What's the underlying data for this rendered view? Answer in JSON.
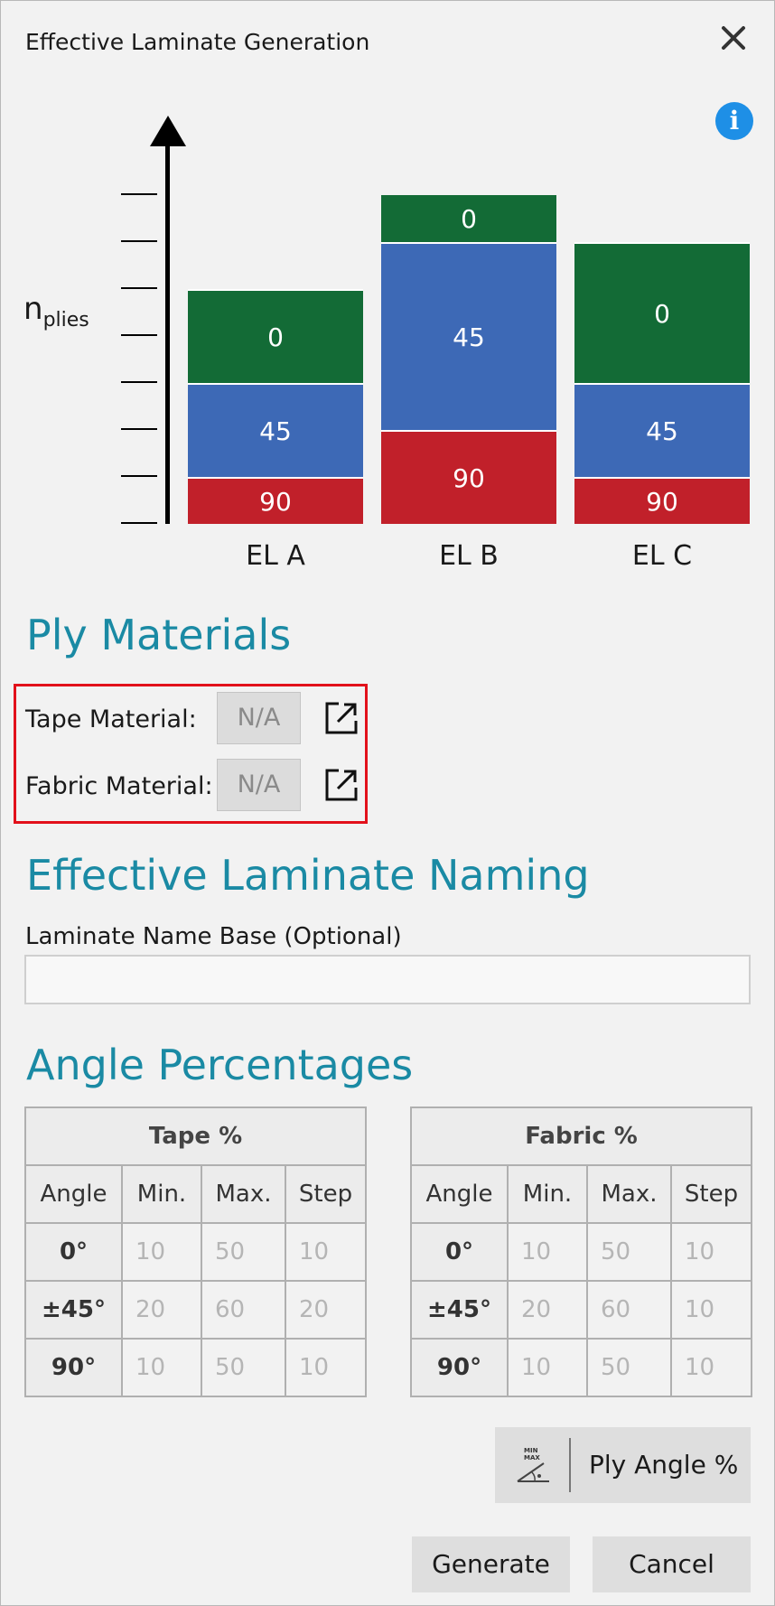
{
  "window": {
    "title": "Effective Laminate Generation"
  },
  "icons": {
    "close": "close-icon",
    "info": "info-icon",
    "external": "external-link-icon",
    "ply_angle": "min-max-angle-icon"
  },
  "colors": {
    "ply_0": "#136b36",
    "ply_45": "#3d69b6",
    "ply_90": "#c1202a",
    "heading": "#1a8aa4",
    "highlight_border": "#e2111b"
  },
  "chart_data": {
    "type": "bar",
    "stacked": true,
    "ylabel": {
      "main": "n",
      "sub": "plies"
    },
    "categories": [
      "EL A",
      "EL B",
      "EL C"
    ],
    "series": [
      {
        "name": "90",
        "values": [
          1,
          2,
          1
        ]
      },
      {
        "name": "45",
        "values": [
          2,
          4,
          2
        ]
      },
      {
        "name": "0",
        "values": [
          2,
          1,
          3
        ]
      }
    ],
    "ylim": [
      0,
      7
    ],
    "yticks": 8,
    "grid": false
  },
  "sections": {
    "ply_materials": "Ply Materials",
    "naming": "Effective Laminate Naming",
    "angles": "Angle Percentages"
  },
  "materials": [
    {
      "label": "Tape Material:",
      "value": "N/A"
    },
    {
      "label": "Fabric Material:",
      "value": "N/A"
    }
  ],
  "naming": {
    "label": "Laminate Name Base (Optional)",
    "value": ""
  },
  "tables": [
    {
      "title": "Tape %",
      "columns": [
        "Angle",
        "Min.",
        "Max.",
        "Step"
      ],
      "rows": [
        [
          "0°",
          "10",
          "50",
          "10"
        ],
        [
          "±45°",
          "20",
          "60",
          "20"
        ],
        [
          "90°",
          "10",
          "50",
          "10"
        ]
      ]
    },
    {
      "title": "Fabric %",
      "columns": [
        "Angle",
        "Min.",
        "Max.",
        "Step"
      ],
      "rows": [
        [
          "0°",
          "10",
          "50",
          "10"
        ],
        [
          "±45°",
          "20",
          "60",
          "10"
        ],
        [
          "90°",
          "10",
          "50",
          "10"
        ]
      ]
    }
  ],
  "buttons": {
    "ply_angle": "Ply Angle %",
    "generate": "Generate",
    "cancel": "Cancel"
  },
  "icon_text": {
    "min": "MIN",
    "max": "MAX"
  }
}
